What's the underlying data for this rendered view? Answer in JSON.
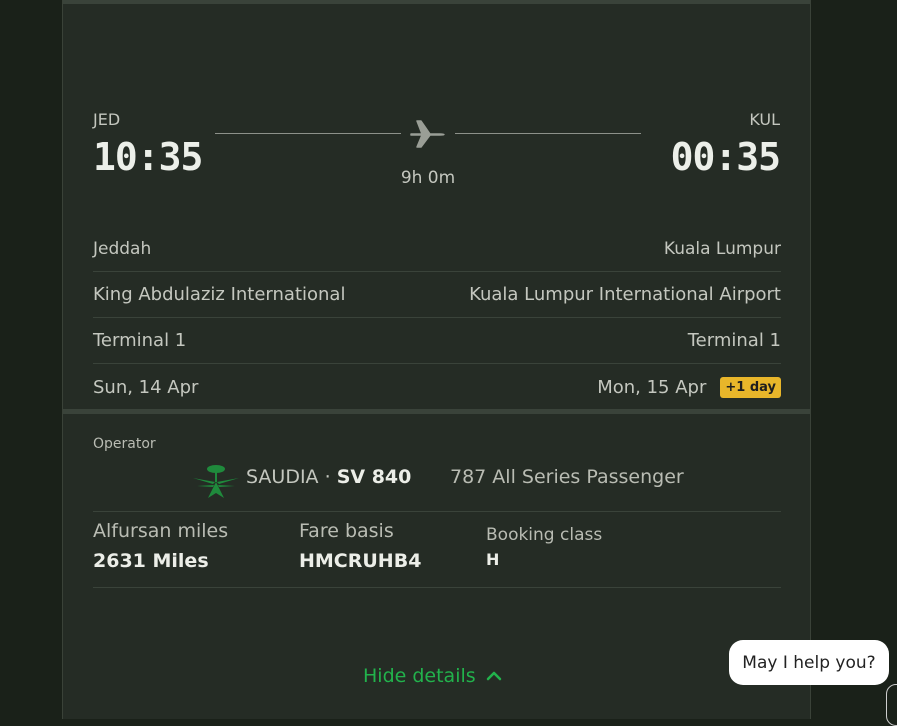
{
  "flight": {
    "origin_code": "JED",
    "origin_time": "10:35",
    "dest_code": "KUL",
    "dest_time": "00:35",
    "duration": "9h 0m"
  },
  "details": [
    {
      "left": "Jeddah",
      "right": "Kuala Lumpur"
    },
    {
      "left": "King Abdulaziz International",
      "right": "Kuala Lumpur International Airport"
    },
    {
      "left": "Terminal 1",
      "right": "Terminal 1"
    },
    {
      "left": "Sun, 14 Apr",
      "right": "Mon, 15 Apr",
      "badge": "+1 day"
    }
  ],
  "operator": {
    "label": "Operator",
    "airline": "SAUDIA",
    "separator": " · ",
    "flight_number": "SV 840",
    "aircraft": "787 All Series Passenger"
  },
  "stats": [
    {
      "label": "Alfursan miles",
      "value": "2631 Miles"
    },
    {
      "label": "Fare basis",
      "value": "HMCRUHB4"
    },
    {
      "label": "Booking class",
      "value": "H"
    }
  ],
  "actions": {
    "hide_details": "Hide details"
  },
  "chat": {
    "bubble_text": "May I help you?"
  },
  "colors": {
    "background": "#1a2119",
    "panel": "#252c25",
    "accent_green": "#22b24c",
    "badge_yellow": "#e8b62a",
    "logo_green": "#1f8a3c"
  },
  "icons": {
    "plane": "plane-icon",
    "chevron": "chevron-up-icon",
    "logo": "saudia-logo-icon"
  }
}
